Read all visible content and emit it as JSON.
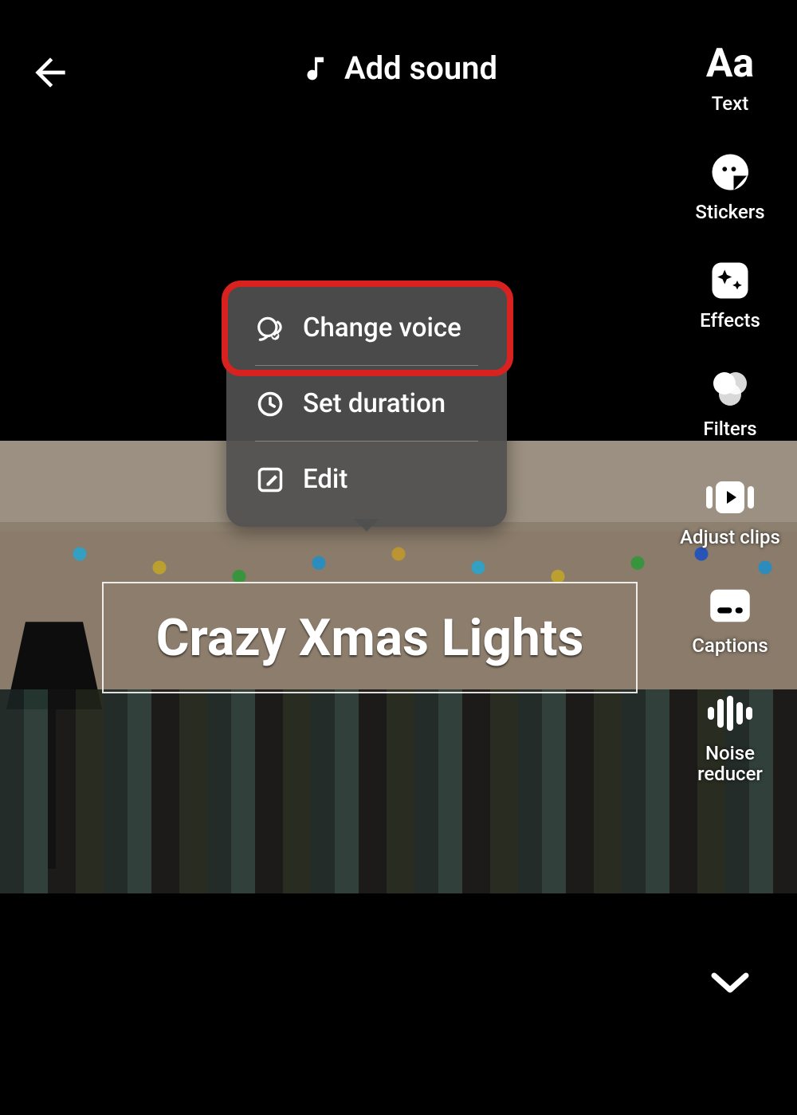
{
  "header": {
    "add_sound_label": "Add sound"
  },
  "rail": {
    "items": [
      {
        "id": "text",
        "label": "Text",
        "icon": "Aa-icon"
      },
      {
        "id": "stickers",
        "label": "Stickers",
        "icon": "sticker-icon"
      },
      {
        "id": "effects",
        "label": "Effects",
        "icon": "sparkle-icon"
      },
      {
        "id": "filters",
        "label": "Filters",
        "icon": "filters-icon"
      },
      {
        "id": "adjust",
        "label": "Adjust clips",
        "icon": "adjust-clips-icon"
      },
      {
        "id": "captions",
        "label": "Captions",
        "icon": "captions-icon"
      },
      {
        "id": "noise",
        "label": "Noise\nreducer",
        "icon": "noise-reducer-icon"
      }
    ]
  },
  "menu": {
    "items": [
      {
        "id": "change_voice",
        "label": "Change voice",
        "icon": "voice-icon",
        "highlighted": true
      },
      {
        "id": "set_duration",
        "label": "Set duration",
        "icon": "clock-icon",
        "highlighted": false
      },
      {
        "id": "edit",
        "label": "Edit",
        "icon": "edit-icon",
        "highlighted": false
      }
    ]
  },
  "caption": {
    "text": "Crazy Xmas Lights"
  },
  "colors": {
    "highlight": "#d9221f"
  }
}
